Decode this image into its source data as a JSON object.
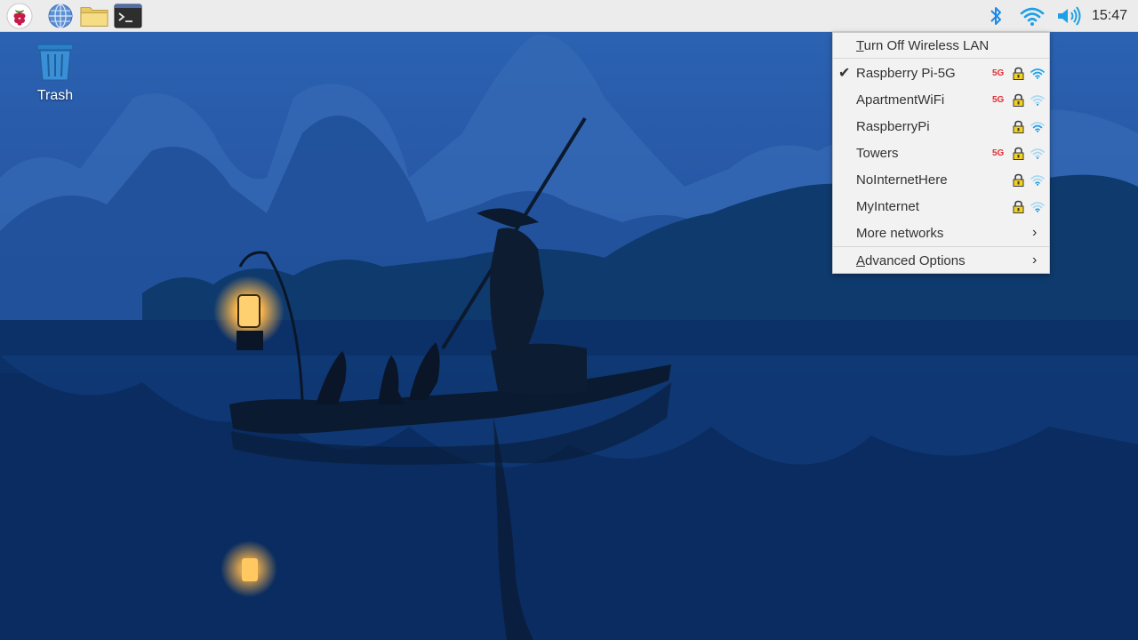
{
  "desktop": {
    "trash_label": "Trash"
  },
  "taskbar": {
    "clock": "15:47"
  },
  "network_menu": {
    "turn_off_first": "T",
    "turn_off_rest": "urn Off Wireless LAN",
    "networks": [
      {
        "name": "Raspberry Pi-5G",
        "connected": true,
        "is_5g": true,
        "secured": true,
        "signal": 1.0
      },
      {
        "name": "ApartmentWiFi",
        "connected": false,
        "is_5g": true,
        "secured": true,
        "signal": 0.25
      },
      {
        "name": "RaspberryPi",
        "connected": false,
        "is_5g": false,
        "secured": true,
        "signal": 0.75
      },
      {
        "name": "Towers",
        "connected": false,
        "is_5g": true,
        "secured": true,
        "signal": 0.25
      },
      {
        "name": "NoInternetHere",
        "connected": false,
        "is_5g": false,
        "secured": true,
        "signal": 0.5
      },
      {
        "name": "MyInternet",
        "connected": false,
        "is_5g": false,
        "secured": true,
        "signal": 0.5
      }
    ],
    "badge_5g": "5G",
    "more_networks": "More networks",
    "advanced_first": "A",
    "advanced_rest": "dvanced Options"
  },
  "colors": {
    "wifi_blue": "#1ea0e6",
    "wifi_dim": "#a9d8f2",
    "badge_red": "#e0303a",
    "lock_yellow": "#f2d21b"
  }
}
